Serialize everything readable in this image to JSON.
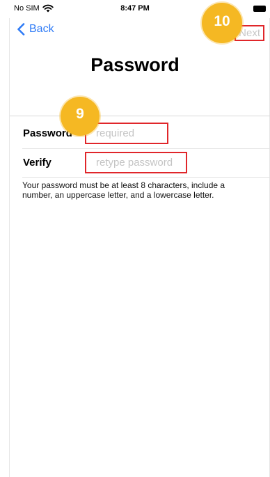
{
  "status_bar": {
    "carrier": "No SIM",
    "time": "8:47 PM"
  },
  "nav": {
    "back_label": "Back",
    "next_label": "Next"
  },
  "page": {
    "title": "Password"
  },
  "form": {
    "password": {
      "label": "Password",
      "placeholder": "required",
      "value": ""
    },
    "verify": {
      "label": "Verify",
      "placeholder": "retype password",
      "value": ""
    },
    "help_text": "Your password must be at least 8 characters, include a number, an uppercase letter, and a lowercase letter."
  },
  "annotations": {
    "step_password": "9",
    "step_next": "10",
    "badge_color": "#f5b823",
    "highlight_color": "#e0262a"
  },
  "colors": {
    "accent": "#2f7bf6",
    "disabled": "#c8c8c8"
  }
}
